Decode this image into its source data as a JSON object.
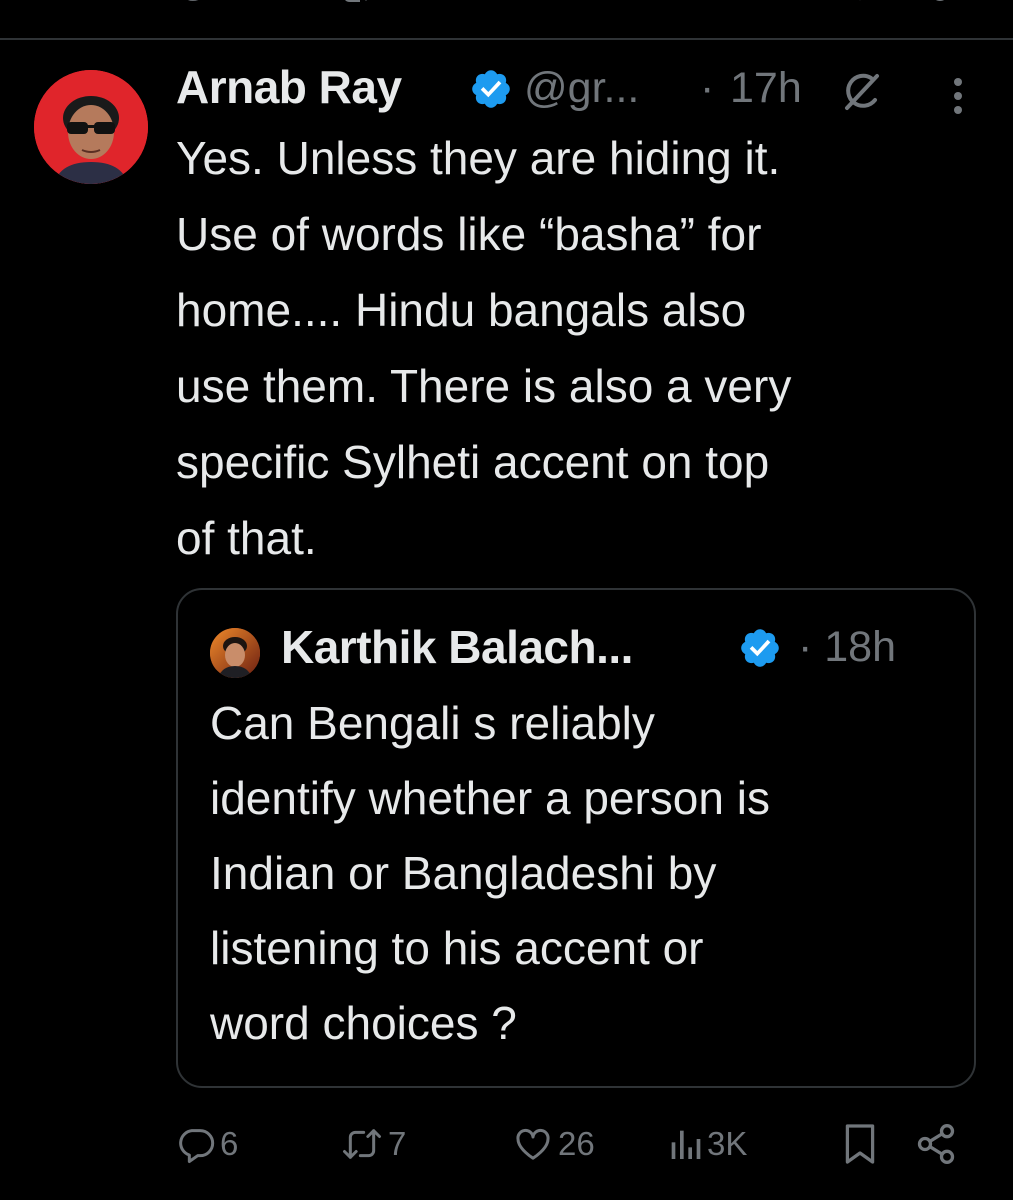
{
  "tweet": {
    "author_name": "Arnab Ray",
    "handle": "@gr...",
    "separator": "·",
    "time": "17h",
    "text_lines": [
      "Yes. Unless they are hiding it.",
      "Use of words like “basha” for",
      "home.... Hindu bangals also",
      "use them. There is also a very",
      "specific Sylheti accent on top",
      "of that."
    ]
  },
  "quote": {
    "author_name": "Karthik Balach...",
    "time": "· 18h",
    "text_lines": [
      "Can Bengali s reliably",
      "identify whether a person is",
      "Indian or Bangladeshi by",
      "listening to his accent or",
      "word choices ?"
    ]
  },
  "actions": {
    "replies": "6",
    "reposts": "7",
    "likes": "26",
    "views": "3K"
  },
  "colors": {
    "background": "#000000",
    "text": "#e7e9ea",
    "muted": "#71767b",
    "border": "#2f3336",
    "verified": "#1d9bf0",
    "avatar_bg": "#e0252b"
  },
  "icons": {
    "verified": "verified-badge-icon",
    "grok": "grok-icon",
    "more": "more-vertical-icon",
    "reply": "reply-icon",
    "repost": "repost-icon",
    "like": "heart-icon",
    "views": "views-icon",
    "bookmark": "bookmark-icon",
    "share": "share-icon"
  }
}
